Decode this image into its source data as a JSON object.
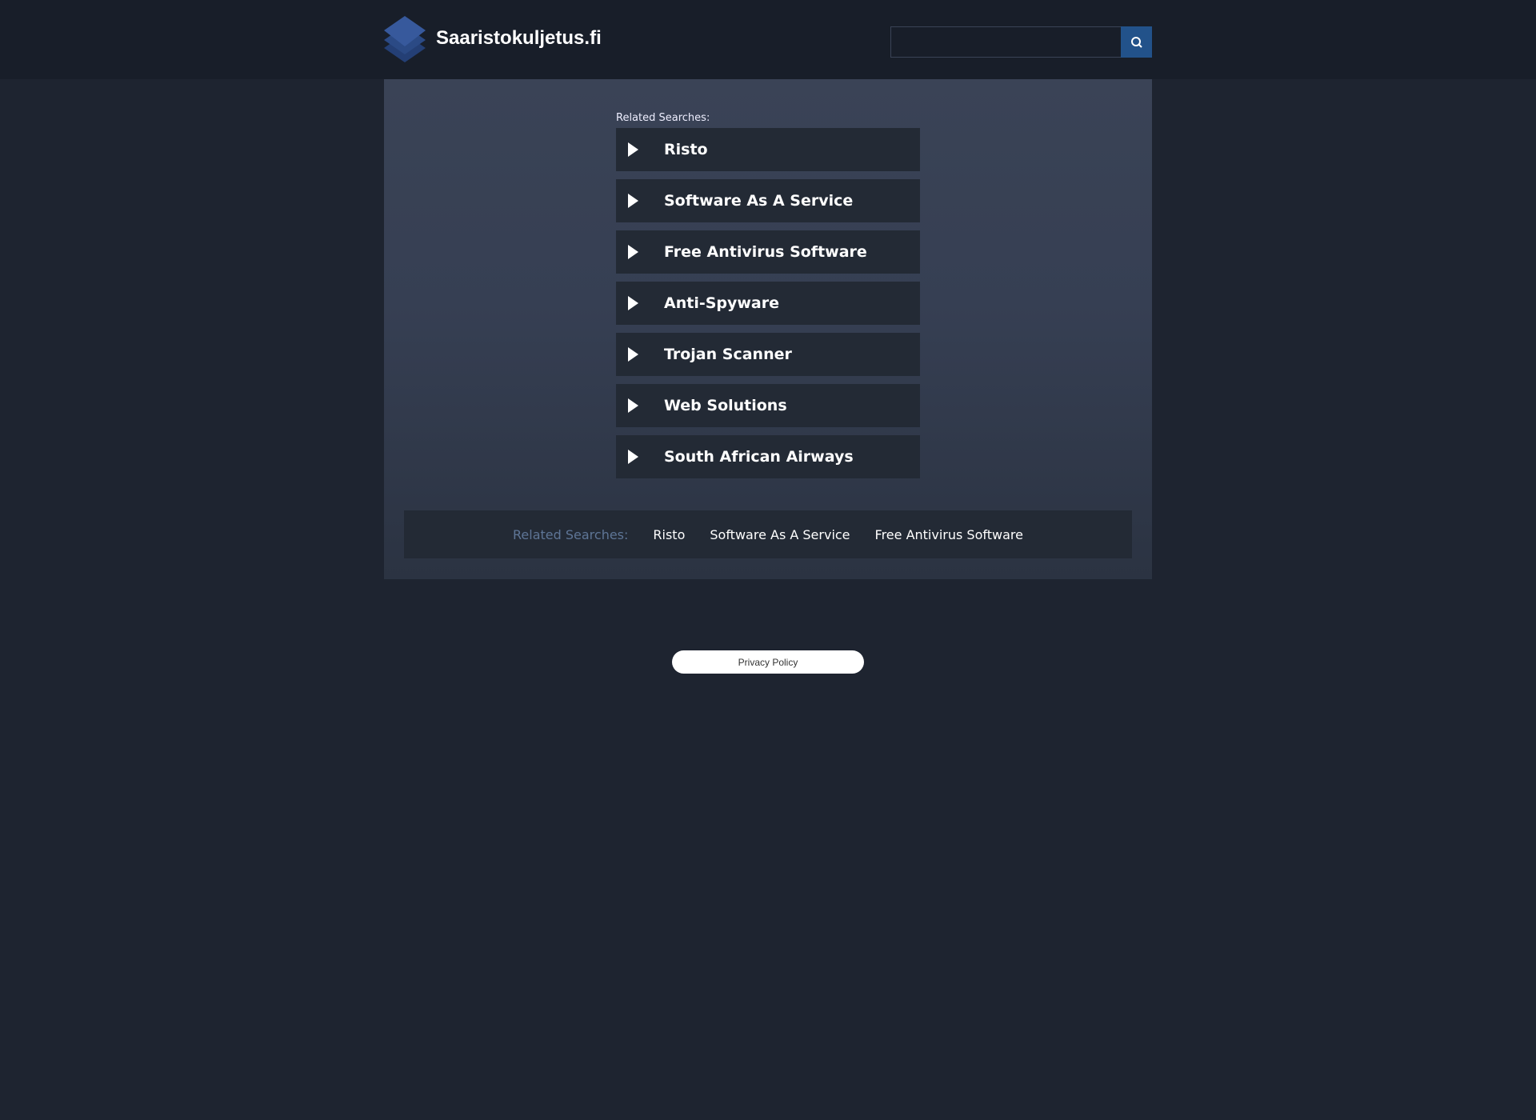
{
  "header": {
    "title": "Saaristokuljetus.fi",
    "search_value": ""
  },
  "main": {
    "related_label": "Related Searches:",
    "items": [
      {
        "label": "Risto"
      },
      {
        "label": "Software As A Service"
      },
      {
        "label": "Free Antivirus Software"
      },
      {
        "label": "Anti-Spyware"
      },
      {
        "label": "Trojan Scanner"
      },
      {
        "label": "Web Solutions"
      },
      {
        "label": "South African Airways"
      }
    ]
  },
  "bottom": {
    "label": "Related Searches:",
    "links": [
      "Risto",
      "Software As A Service",
      "Free Antivirus Software"
    ]
  },
  "footer": {
    "privacy": "Privacy Policy"
  },
  "colors": {
    "accent": "#22528a",
    "background": "#1e2430"
  }
}
